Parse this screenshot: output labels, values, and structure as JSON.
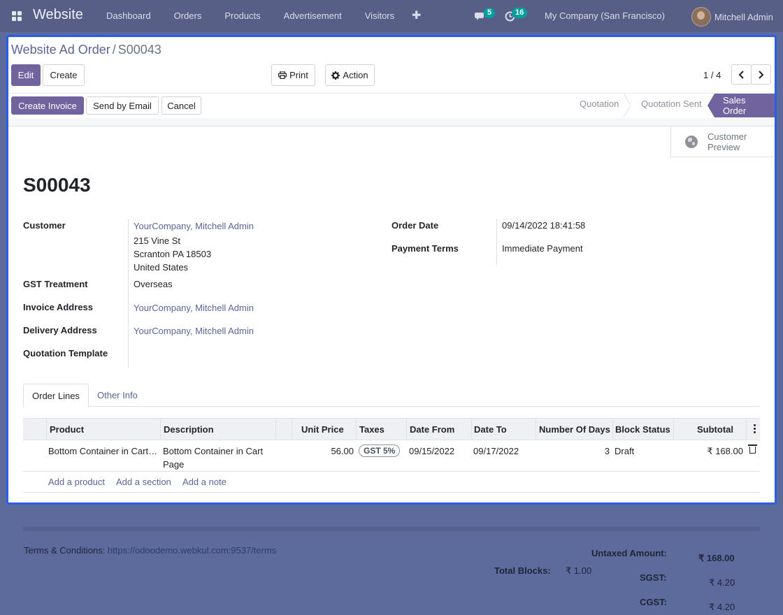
{
  "navbar": {
    "brand": "Website",
    "menu": [
      "Dashboard",
      "Orders",
      "Products",
      "Advertisement",
      "Visitors"
    ],
    "plus": "✚",
    "messages_count": "5",
    "activities_count": "16",
    "company": "My Company (San Francisco)",
    "user": "Mitchell Admin"
  },
  "breadcrumb": {
    "parent": "Website Ad Order",
    "separator": "/",
    "current": "S00043"
  },
  "buttons": {
    "edit": "Edit",
    "create": "Create",
    "print": "Print",
    "action": "Action",
    "create_invoice": "Create Invoice",
    "send_email": "Send by Email",
    "cancel": "Cancel"
  },
  "pager": {
    "value": "1 / 4"
  },
  "stages": [
    "Quotation",
    "Quotation Sent",
    "Sales Order"
  ],
  "active_stage": "Sales Order",
  "customer_preview": {
    "line1": "Customer",
    "line2": "Preview"
  },
  "order": {
    "name": "S00043",
    "labels": {
      "customer": "Customer",
      "gst": "GST Treatment",
      "invoice_address": "Invoice Address",
      "delivery_address": "Delivery Address",
      "quotation_template": "Quotation Template",
      "order_date": "Order Date",
      "payment_terms": "Payment Terms"
    },
    "customer": "YourCompany, Mitchell Admin",
    "address": [
      "215 Vine St",
      "Scranton PA 18503",
      "United States"
    ],
    "gst": "Overseas",
    "invoice_address": "YourCompany, Mitchell Admin",
    "delivery_address": "YourCompany, Mitchell Admin",
    "order_date": "09/14/2022 18:41:58",
    "payment_terms": "Immediate Payment"
  },
  "tabs": [
    "Order Lines",
    "Other Info"
  ],
  "table": {
    "columns": [
      "Product",
      "Description",
      "Unit Price",
      "Taxes",
      "Date From",
      "Date To",
      "Number Of Days",
      "Block Status",
      "Subtotal"
    ],
    "rows": [
      {
        "product": "Bottom Container in Cart…",
        "description_1": "Bottom Container in Cart",
        "description_2": "Page",
        "unit_price": "56.00",
        "taxes": "GST 5%",
        "date_from": "09/15/2022",
        "date_to": "09/17/2022",
        "days": "3",
        "status": "Draft",
        "subtotal": "₹ 168.00"
      }
    ],
    "add_links": [
      "Add a product",
      "Add a section",
      "Add a note"
    ]
  },
  "footer": {
    "terms_label": "Terms & Conditions:",
    "terms_url": "https://odoodemo.webkul.com:9537/terms",
    "untaxed_label": "Untaxed Amount:",
    "untaxed_value": "₹ 168.00",
    "blocks_label": "Total Blocks:",
    "blocks_value": "₹ 1.00",
    "sgst_label": "SGST:",
    "sgst_value": "₹ 4.20",
    "cgst_label": "CGST:",
    "cgst_value": "₹ 4.20"
  }
}
